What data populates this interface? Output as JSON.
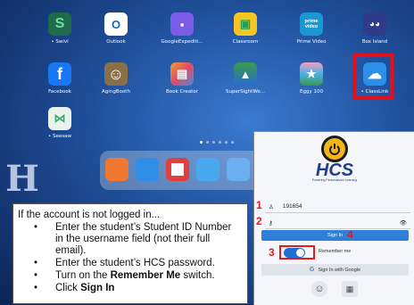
{
  "home_screen": {
    "apps": [
      {
        "label": "• Swivl",
        "glyph": "S",
        "color": "#2a8a5e"
      },
      {
        "label": "Outlook",
        "glyph": "O",
        "color": "#1666c4"
      },
      {
        "label": "GoogleExpediti...",
        "glyph": "▪",
        "color": "#6a4ee0"
      },
      {
        "label": "Classroom",
        "glyph": "▣",
        "color": "#24a05a"
      },
      {
        "label": "Prime Video",
        "glyph": "prime video",
        "color": "#1a98d4"
      },
      {
        "label": "Box Island",
        "glyph": "◕◕",
        "color": "#2f3a8a"
      },
      {
        "label": "Facebook",
        "glyph": "f",
        "color": "#1877f2"
      },
      {
        "label": "AgingBooth",
        "glyph": "☺",
        "color": "#8a7048"
      },
      {
        "label": "Book Creator",
        "glyph": "▤",
        "color": "#e04a6a"
      },
      {
        "label": "SuperSightWo...",
        "glyph": "▲",
        "color": "#3a9a4a"
      },
      {
        "label": "Eggy 100",
        "glyph": "★",
        "color": "#4bb0e8"
      },
      {
        "label": "• ClassLink",
        "glyph": "☁",
        "color": "#2b8ee8"
      },
      {
        "label": "• Seesaw",
        "glyph": "⋈",
        "color": "#e9f3ec"
      }
    ],
    "pager_dots": 6,
    "logo_letter": "H"
  },
  "instructions": {
    "intro": "If the account is not logged in...",
    "steps": [
      {
        "text": "Enter the student’s Student ID Number in the username field (not their full email)."
      },
      {
        "text": "Enter the student’s HCS password."
      },
      {
        "pre": "Turn on the ",
        "bold": "Remember Me",
        "post": " switch."
      },
      {
        "pre": "Click ",
        "bold": "Sign In",
        "post": ""
      }
    ]
  },
  "signin": {
    "brand": "HCS",
    "tagline": "Powering Personalized Learning",
    "username_value": "191654",
    "password_value": "",
    "signin_label": "Sign In",
    "remember_label": "Remember me",
    "remember_on": true,
    "google_label": "Sign In with Google",
    "step_numbers": [
      "1",
      "2",
      "3",
      "4"
    ]
  },
  "colors": {
    "accent": "#2f7fd6",
    "callout_red": "#e31b1b"
  }
}
